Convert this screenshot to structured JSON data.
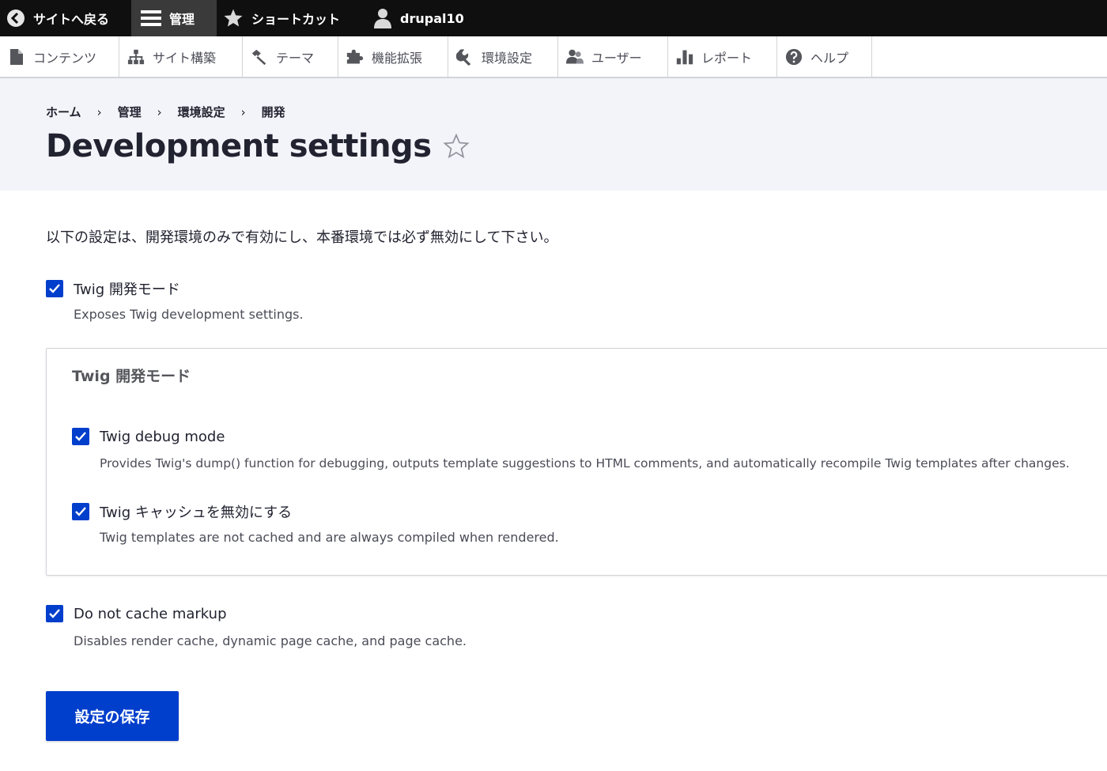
{
  "toolbar": {
    "back_label": "サイトへ戻る",
    "manage_label": "管理",
    "shortcuts_label": "ショートカット",
    "user_label": "drupal10"
  },
  "tray": {
    "items": [
      {
        "label": "コンテンツ",
        "icon": "file-icon"
      },
      {
        "label": "サイト構築",
        "icon": "sitemap-icon"
      },
      {
        "label": "テーマ",
        "icon": "paintbrush-icon"
      },
      {
        "label": "機能拡張",
        "icon": "puzzle-icon"
      },
      {
        "label": "環境設定",
        "icon": "wrench-icon"
      },
      {
        "label": "ユーザー",
        "icon": "people-icon"
      },
      {
        "label": "レポート",
        "icon": "bar-chart-icon"
      },
      {
        "label": "ヘルプ",
        "icon": "help-icon"
      }
    ]
  },
  "breadcrumb": [
    "ホーム",
    "管理",
    "環境設定",
    "開発"
  ],
  "page": {
    "title": "Development settings",
    "intro": "以下の設定は、開発環境のみで有効にし、本番環境では必ず無効にして下さい。"
  },
  "form": {
    "twig_mode": {
      "label": "Twig 開発モード",
      "description": "Exposes Twig development settings.",
      "checked": true
    },
    "fieldset_legend": "Twig 開発モード",
    "twig_debug": {
      "label": "Twig debug mode",
      "description": "Provides Twig's dump() function for debugging, outputs template suggestions to HTML comments, and automatically recompile Twig templates after changes.",
      "checked": true
    },
    "twig_cache": {
      "label": "Twig キャッシュを無効にする",
      "description": "Twig templates are not cached and are always compiled when rendered.",
      "checked": true
    },
    "no_cache_markup": {
      "label": "Do not cache markup",
      "description": "Disables render cache, dynamic page cache, and page cache.",
      "checked": true
    },
    "save_label": "設定の保存"
  },
  "colors": {
    "accent": "#003ecc",
    "toolbar_bg": "#0f0f0f",
    "header_bg": "#f3f4f9"
  }
}
